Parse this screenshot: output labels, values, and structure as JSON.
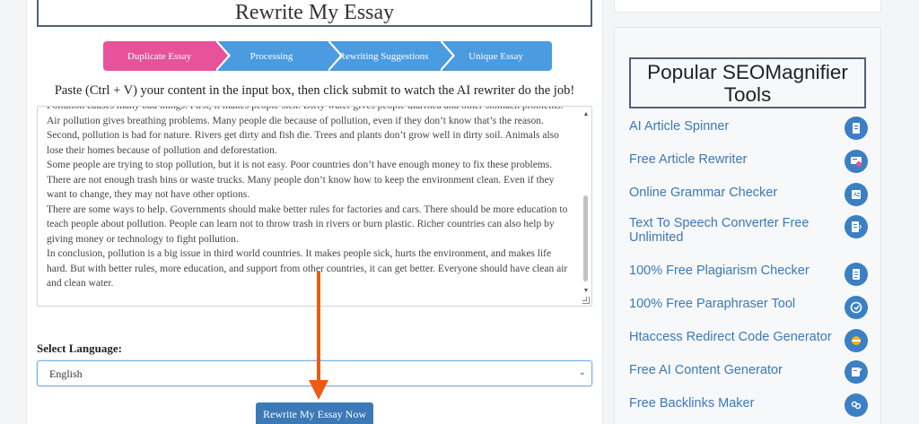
{
  "header": {
    "title": "Rewrite My Essay"
  },
  "steps": [
    {
      "label": "Duplicate Essay"
    },
    {
      "label": "Processing"
    },
    {
      "label": "Rewriting Suggestions"
    },
    {
      "label": "Unique Essay"
    }
  ],
  "instruction": "Paste (Ctrl + V) your content in the input box, then click submit to watch the AI rewriter do the job!",
  "essay": {
    "lines": [
      "Pollution causes many bad things. First, it makes people sick. Dirty water gives people diarrhea and other stomach problems.",
      "Air pollution gives breathing problems. Many people die because of pollution, even if they don’t know that’s the reason.",
      "Second, pollution is bad for nature. Rivers get dirty and fish die. Trees and plants don’t grow well in dirty soil. Animals also",
      "lose their homes because of pollution and deforestation.",
      "Some people are trying to stop pollution, but it is not easy. Poor countries don’t have enough money to fix these problems.",
      "There are not enough trash bins or waste trucks. Many people don’t know how to keep the environment clean. Even if they",
      "want to change, they may not have other options.",
      "There are some ways to help. Governments should make better rules for factories and cars. There should be more education to",
      "teach people about pollution. People can learn not to throw trash in rivers or burn plastic. Richer countries can also help by",
      "giving money or technology to fight pollution.",
      "In conclusion, pollution is a big issue in third world countries. It makes people sick, hurts the environment, and makes life",
      "hard. But with better rules, more education, and support from other countries, it can get better. Everyone should have clean air",
      "and clean water."
    ]
  },
  "language": {
    "label": "Select Language:",
    "selected": "English"
  },
  "submit": {
    "label": "Rewrite My Essay Now"
  },
  "sidebar": {
    "title": "Popular SEOMagnifier Tools",
    "tools": [
      {
        "label": "AI Article Spinner",
        "icon": "article-spinner-icon"
      },
      {
        "label": "Free Article Rewriter",
        "icon": "article-rewriter-icon"
      },
      {
        "label": "Online Grammar Checker",
        "icon": "grammar-checker-icon"
      },
      {
        "label": "Text To Speech Converter Free Unlimited",
        "icon": "text-to-speech-icon"
      },
      {
        "label": "100% Free Plagiarism Checker",
        "icon": "plagiarism-checker-icon"
      },
      {
        "label": "100% Free Paraphraser Tool",
        "icon": "paraphraser-icon"
      },
      {
        "label": "Htaccess Redirect Code Generator",
        "icon": "htaccess-icon"
      },
      {
        "label": "Free AI Content Generator",
        "icon": "content-generator-icon"
      },
      {
        "label": "Free Backlinks Maker",
        "icon": "backlinks-icon"
      }
    ]
  },
  "colors": {
    "step_active": "#e8529a",
    "step_inactive": "#4a9be0",
    "button": "#3b79b7",
    "link": "#3b79b7",
    "annotation_arrow": "#ee5a12"
  }
}
